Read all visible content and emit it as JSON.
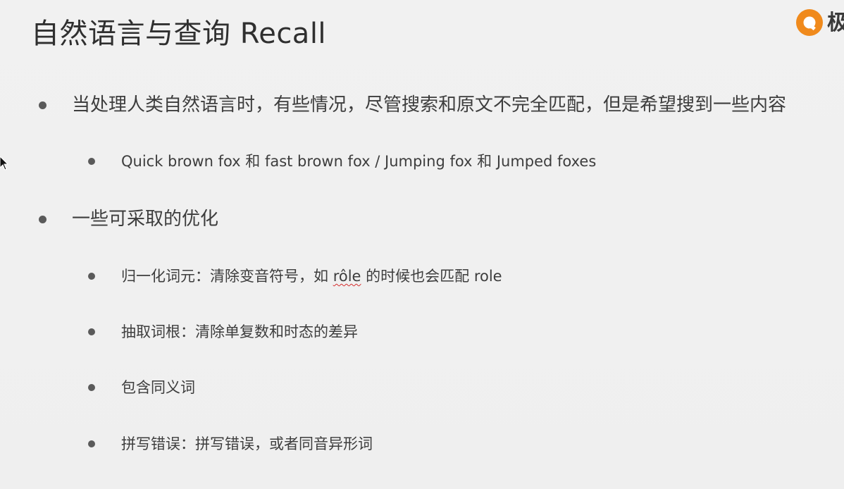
{
  "slide": {
    "title": "自然语言与查询 Recall",
    "logo_char": "极",
    "logo_icon": "orange-circle-logo-icon",
    "cursor_icon": "mouse-pointer-icon",
    "bullet_color": "#5a5a5a",
    "logo_color": "#f08a1c",
    "items": [
      {
        "level": 1,
        "text": "当处理人类自然语言时，有些情况，尽管搜索和原文不完全匹配，但是希望搜到一些内容"
      },
      {
        "level": 2,
        "text": "Quick brown fox 和 fast brown fox / Jumping fox 和 Jumped foxes"
      },
      {
        "level": 1,
        "text": "一些可采取的优化"
      },
      {
        "level": 2,
        "text_before": "归一化词元：清除变音符号，如 ",
        "text_marked": "rôle",
        "text_after": " 的时候也会匹配 role"
      },
      {
        "level": 2,
        "text": "抽取词根：清除单复数和时态的差异"
      },
      {
        "level": 2,
        "text": "包含同义词"
      },
      {
        "level": 2,
        "text": "拼写错误：拼写错误，或者同音异形词"
      }
    ]
  }
}
